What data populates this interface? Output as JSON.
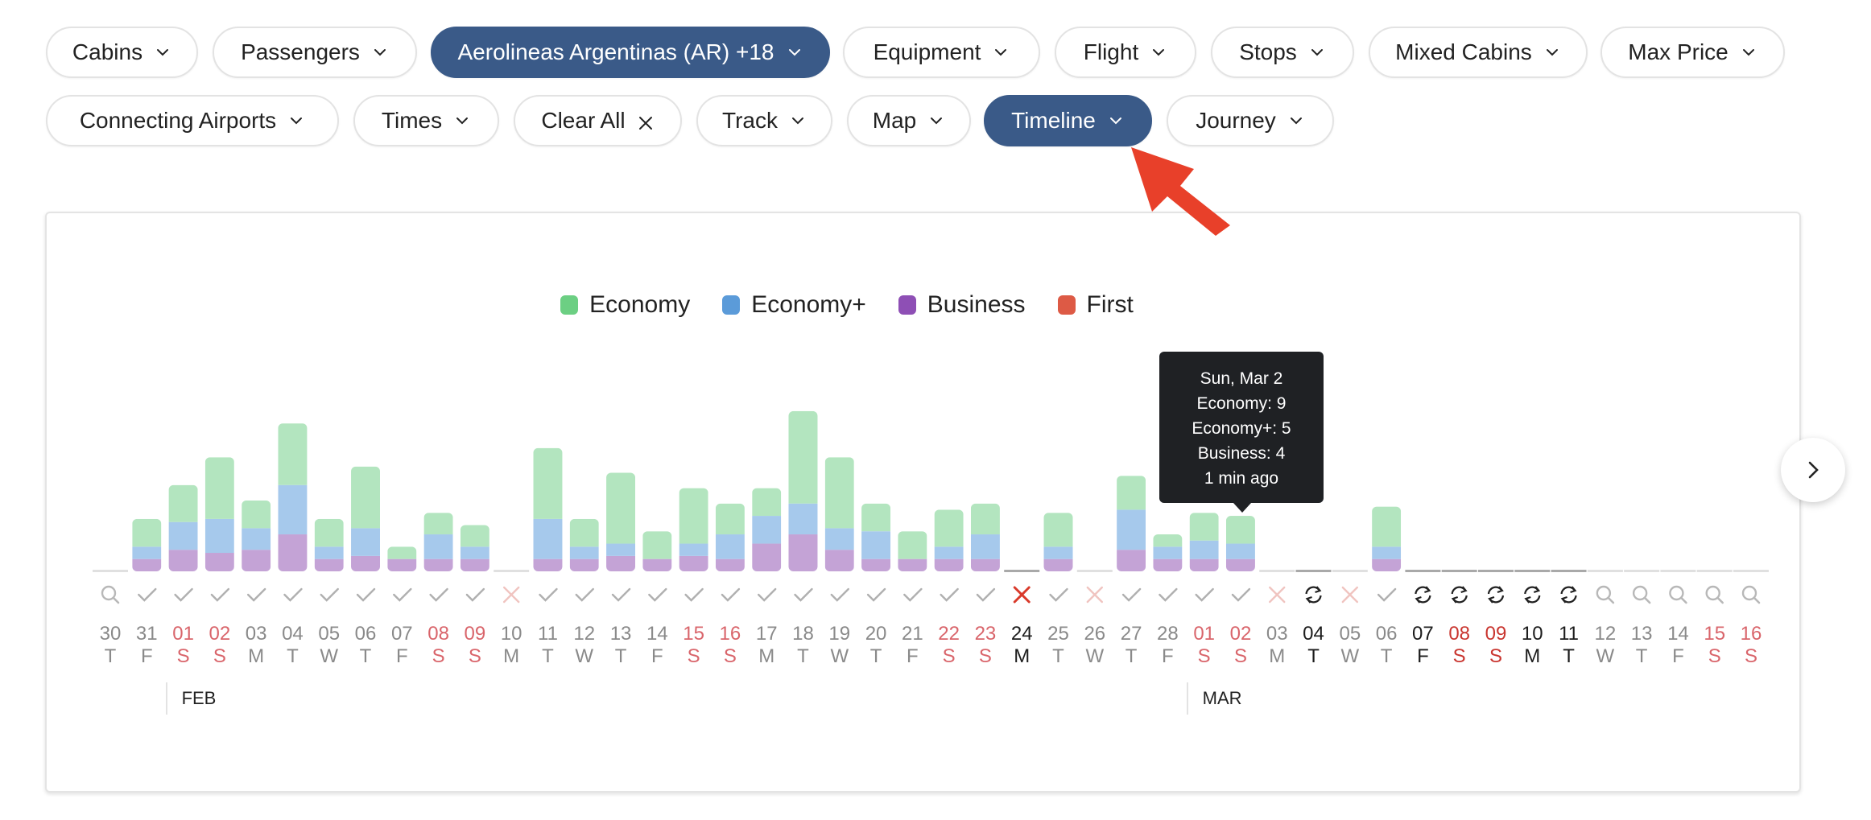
{
  "filters": {
    "row1": [
      {
        "label": "Cabins",
        "icon": "chevron-down-icon",
        "active": false
      },
      {
        "label": "Passengers",
        "icon": "chevron-down-icon",
        "active": false
      },
      {
        "label": "Aerolineas Argentinas (AR) +18",
        "icon": "chevron-down-icon",
        "active": true
      },
      {
        "label": "Equipment",
        "icon": "chevron-down-icon",
        "active": false
      },
      {
        "label": "Flight",
        "icon": "chevron-down-icon",
        "active": false
      },
      {
        "label": "Stops",
        "icon": "chevron-down-icon",
        "active": false
      },
      {
        "label": "Mixed Cabins",
        "icon": "chevron-down-icon",
        "active": false
      },
      {
        "label": "Max Price",
        "icon": "chevron-down-icon",
        "active": false
      }
    ],
    "row2": [
      {
        "label": "Connecting Airports",
        "icon": "chevron-down-icon",
        "active": false
      },
      {
        "label": "Times",
        "icon": "chevron-down-icon",
        "active": false
      },
      {
        "label": "Clear All",
        "icon": "close-icon",
        "active": false
      },
      {
        "label": "Track",
        "icon": "chevron-down-icon",
        "active": false
      },
      {
        "label": "Map",
        "icon": "chevron-down-icon",
        "active": false
      },
      {
        "label": "Timeline",
        "icon": "chevron-down-icon",
        "active": true
      },
      {
        "label": "Journey",
        "icon": "chevron-down-icon",
        "active": false
      }
    ]
  },
  "colors": {
    "active_chip": "#3a5a88",
    "economy": "#6ccf83",
    "economy_plus": "#5b9bd9",
    "business": "#8e4fb5",
    "first": "#dd5a45",
    "weekend": "#d9535a",
    "annotation_arrow": "#e8402a"
  },
  "tooltip": {
    "title": "Sun, Mar 2",
    "lines": [
      "Economy: 9",
      "Economy+: 5",
      "Business: 4"
    ],
    "updated": "1 min ago"
  },
  "months": [
    {
      "label": "FEB",
      "start_index": 2
    },
    {
      "label": "MAR",
      "start_index": 30
    }
  ],
  "chart_data": {
    "type": "bar",
    "stacked": true,
    "title": "",
    "legend": [
      "Economy",
      "Economy+",
      "Business",
      "First"
    ],
    "legend_position": "top-center",
    "highlighted_index": 32,
    "categories": [
      "30",
      "31",
      "01",
      "02",
      "03",
      "04",
      "05",
      "06",
      "07",
      "08",
      "09",
      "10",
      "11",
      "12",
      "13",
      "14",
      "15",
      "16",
      "17",
      "18",
      "19",
      "20",
      "21",
      "22",
      "23",
      "24",
      "25",
      "26",
      "27",
      "28",
      "01",
      "02",
      "03",
      "04",
      "05",
      "06",
      "07",
      "08",
      "09",
      "10",
      "11",
      "12",
      "13",
      "14",
      "15",
      "16"
    ],
    "weekdays": [
      "T",
      "F",
      "S",
      "S",
      "M",
      "T",
      "W",
      "T",
      "F",
      "S",
      "S",
      "M",
      "T",
      "W",
      "T",
      "F",
      "S",
      "S",
      "M",
      "T",
      "W",
      "T",
      "F",
      "S",
      "S",
      "M",
      "T",
      "W",
      "T",
      "F",
      "S",
      "S",
      "M",
      "T",
      "W",
      "T",
      "F",
      "S",
      "S",
      "M",
      "T",
      "W",
      "T",
      "F",
      "S",
      "S"
    ],
    "status": [
      "search",
      "check",
      "check",
      "check",
      "check",
      "check",
      "check",
      "check",
      "check",
      "check",
      "check",
      "cross-faint",
      "check",
      "check",
      "check",
      "check",
      "check",
      "check",
      "check",
      "check",
      "check",
      "check",
      "check",
      "check",
      "check",
      "cross",
      "check",
      "cross-faint",
      "check",
      "check",
      "check",
      "check",
      "cross-faint",
      "refresh",
      "cross-faint",
      "check",
      "refresh",
      "refresh",
      "refresh",
      "refresh",
      "refresh",
      "search",
      "search",
      "search",
      "search",
      "search"
    ],
    "label_style": [
      "muted",
      "muted",
      "weekend",
      "weekend",
      "muted",
      "muted",
      "muted",
      "muted",
      "muted",
      "weekend",
      "weekend",
      "muted",
      "muted",
      "muted",
      "muted",
      "muted",
      "weekend",
      "weekend",
      "muted",
      "muted",
      "muted",
      "muted",
      "muted",
      "weekend",
      "weekend",
      "dark",
      "muted",
      "muted",
      "muted",
      "muted",
      "weekend",
      "weekend",
      "muted",
      "dark",
      "muted",
      "muted",
      "dark",
      "weekend-dark",
      "weekend-dark",
      "dark",
      "dark",
      "muted",
      "muted",
      "muted",
      "weekend",
      "weekend"
    ],
    "series": [
      {
        "name": "Business",
        "values": [
          0,
          4,
          7,
          6,
          7,
          12,
          4,
          5,
          4,
          4,
          4,
          0,
          4,
          4,
          5,
          4,
          5,
          4,
          9,
          12,
          7,
          4,
          4,
          4,
          4,
          0,
          4,
          0,
          7,
          4,
          4,
          4,
          0,
          0,
          0,
          4,
          0,
          0,
          0,
          0,
          0,
          0,
          0,
          0,
          0,
          0
        ]
      },
      {
        "name": "Economy+",
        "values": [
          0,
          4,
          9,
          11,
          7,
          16,
          4,
          9,
          0,
          8,
          4,
          0,
          13,
          4,
          4,
          0,
          4,
          8,
          9,
          10,
          7,
          9,
          0,
          4,
          8,
          0,
          4,
          0,
          13,
          4,
          6,
          5,
          0,
          0,
          0,
          4,
          0,
          0,
          0,
          0,
          0,
          0,
          0,
          0,
          0,
          0
        ]
      },
      {
        "name": "Economy",
        "values": [
          0,
          9,
          12,
          20,
          9,
          20,
          9,
          20,
          4,
          7,
          7,
          0,
          23,
          9,
          23,
          9,
          18,
          10,
          9,
          30,
          23,
          9,
          9,
          12,
          10,
          0,
          11,
          0,
          11,
          4,
          9,
          9,
          0,
          0,
          0,
          13,
          0,
          0,
          0,
          0,
          0,
          0,
          0,
          0,
          0,
          0
        ]
      },
      {
        "name": "First",
        "values": [
          0,
          0,
          0,
          0,
          0,
          0,
          0,
          0,
          0,
          0,
          0,
          0,
          0,
          0,
          0,
          0,
          0,
          0,
          0,
          0,
          0,
          0,
          0,
          0,
          0,
          0,
          0,
          0,
          0,
          0,
          0,
          0,
          0,
          0,
          0,
          0,
          0,
          0,
          0,
          0,
          0,
          0,
          0,
          0,
          0,
          0
        ]
      }
    ],
    "xlabel": "",
    "ylabel": "",
    "grid": false
  },
  "legend_labels": [
    "Economy",
    "Economy+",
    "Business",
    "First"
  ],
  "next_button": {
    "icon": "chevron-right-icon"
  }
}
